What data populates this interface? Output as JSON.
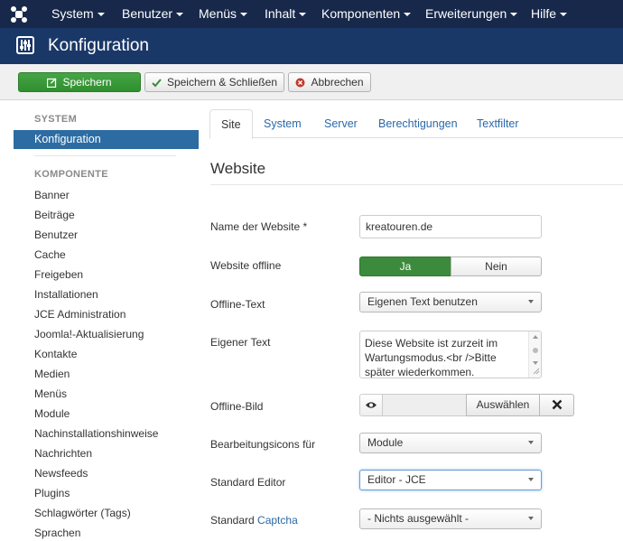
{
  "nav": {
    "menus": [
      "System",
      "Benutzer",
      "Menüs",
      "Inhalt",
      "Komponenten",
      "Erweiterungen",
      "Hilfe"
    ]
  },
  "header": {
    "title": "Konfiguration"
  },
  "toolbar": {
    "save": "Speichern",
    "save_close": "Speichern & Schließen",
    "cancel": "Abbrechen"
  },
  "sidebar": {
    "system_heading": "SYSTEM",
    "active": "Konfiguration",
    "component_heading": "KOMPONENTE",
    "items": [
      "Banner",
      "Beiträge",
      "Benutzer",
      "Cache",
      "Freigeben",
      "Installationen",
      "JCE Administration",
      "Joomla!-Aktualisierung",
      "Kontakte",
      "Medien",
      "Menüs",
      "Module",
      "Nachinstallationshinweise",
      "Nachrichten",
      "Newsfeeds",
      "Plugins",
      "Schlagwörter (Tags)",
      "Sprachen"
    ]
  },
  "tabs": [
    "Site",
    "System",
    "Server",
    "Berechtigungen",
    "Textfilter"
  ],
  "section": {
    "title": "Website"
  },
  "form": {
    "site_name_label": "Name der Website *",
    "site_name_value": "kreatouren.de",
    "offline_label": "Website offline",
    "offline_yes": "Ja",
    "offline_no": "Nein",
    "offline_text_label": "Offline-Text",
    "offline_text_value": "Eigenen Text benutzen",
    "custom_text_label": "Eigener Text",
    "custom_text_value": "Diese Website ist zurzeit im Wartungsmodus.<br />Bitte später wiederkommen.",
    "offline_image_label": "Offline-Bild",
    "select_button": "Auswählen",
    "edit_icons_label": "Bearbeitungsicons für",
    "edit_icons_value": "Module",
    "editor_label": "Standard Editor",
    "editor_value": "Editor - JCE",
    "captcha_label_prefix": "Standard",
    "captcha_label_link": "Captcha",
    "captcha_value": "- Nichts ausgewählt -"
  },
  "colors": {
    "navbar": "#17284a",
    "header": "#1a3867",
    "active": "#2d6ca2",
    "save_green": "#3c8b3c",
    "link": "#2a69a9"
  }
}
